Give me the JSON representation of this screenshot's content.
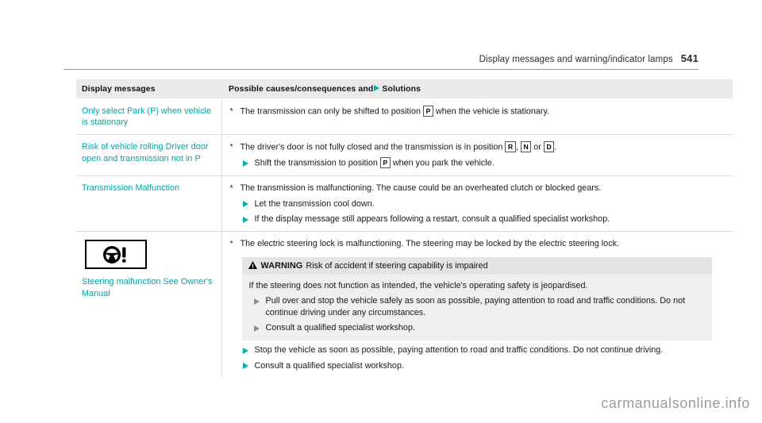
{
  "page_header": {
    "title": "Display messages and warning/indicator lamps",
    "page_number": "541"
  },
  "table": {
    "columns": {
      "left": "Display messages",
      "right_before_arrow": "Possible causes/consequences and",
      "right_after_arrow": "Solutions"
    },
    "rows": [
      {
        "message": "Only select Park (P) when vehicle is stationary",
        "icon": null,
        "entries": [
          {
            "type": "cause",
            "marker": "asterisk",
            "parts": [
              {
                "t": "text",
                "v": "The transmission can only be shifted to position "
              },
              {
                "t": "gear",
                "v": "P"
              },
              {
                "t": "text",
                "v": " when the vehicle is stationary."
              }
            ]
          }
        ]
      },
      {
        "message": "Risk of vehicle rolling Driver door open and transmission not in P",
        "icon": null,
        "entries": [
          {
            "type": "cause",
            "marker": "asterisk",
            "parts": [
              {
                "t": "text",
                "v": "The driver's door is not fully closed and the transmission is in position "
              },
              {
                "t": "gear",
                "v": "R"
              },
              {
                "t": "text",
                "v": ", "
              },
              {
                "t": "gear",
                "v": "N"
              },
              {
                "t": "text",
                "v": " or "
              },
              {
                "t": "gear",
                "v": "D"
              },
              {
                "t": "text",
                "v": "."
              }
            ]
          },
          {
            "type": "solution",
            "marker": "triangle",
            "parts": [
              {
                "t": "text",
                "v": "Shift the transmission to position "
              },
              {
                "t": "gear",
                "v": "P"
              },
              {
                "t": "text",
                "v": " when you park the vehicle."
              }
            ]
          }
        ]
      },
      {
        "message": "Transmission Malfunction",
        "icon": null,
        "entries": [
          {
            "type": "cause",
            "marker": "asterisk",
            "parts": [
              {
                "t": "text",
                "v": "The transmission is malfunctioning. The cause could be an overheated clutch or blocked gears."
              }
            ]
          },
          {
            "type": "solution",
            "marker": "triangle",
            "parts": [
              {
                "t": "text",
                "v": "Let the transmission cool down."
              }
            ]
          },
          {
            "type": "solution",
            "marker": "triangle",
            "parts": [
              {
                "t": "text",
                "v": "If the display message still appears following a restart, consult a qualified specialist workshop."
              }
            ]
          }
        ]
      },
      {
        "message": "Steering malfunction See Owner's Manual",
        "icon": "steering-wheel-warning-icon",
        "entries": [
          {
            "type": "cause",
            "marker": "asterisk",
            "parts": [
              {
                "t": "text",
                "v": "The electric steering lock is malfunctioning. The steering may be locked by the electric steering lock."
              }
            ]
          },
          {
            "type": "warning_box",
            "label": "WARNING",
            "heading": "Risk of accident if steering capability is impaired",
            "body": "If the steering does not function as intended, the vehicle's operating safety is jeopardised.",
            "actions": [
              "Pull over and stop the vehicle safely as soon as possible, paying attention to road and traffic conditions. Do not continue driving under any circumstances.",
              "Consult a qualified specialist workshop."
            ]
          },
          {
            "type": "solution",
            "marker": "triangle",
            "parts": [
              {
                "t": "text",
                "v": "Stop the vehicle as soon as possible, paying attention to road and traffic conditions. Do not continue driving."
              }
            ]
          },
          {
            "type": "solution",
            "marker": "triangle",
            "parts": [
              {
                "t": "text",
                "v": "Consult a qualified specialist workshop."
              }
            ]
          }
        ]
      }
    ]
  },
  "watermark": "carmanualsonline.info",
  "colors": {
    "accent_teal": "#00a3a3",
    "marker_teal": "#00b0b0",
    "header_bg": "#eaeaea",
    "warning_bg": "#efefef",
    "rule": "#8a96a0"
  }
}
